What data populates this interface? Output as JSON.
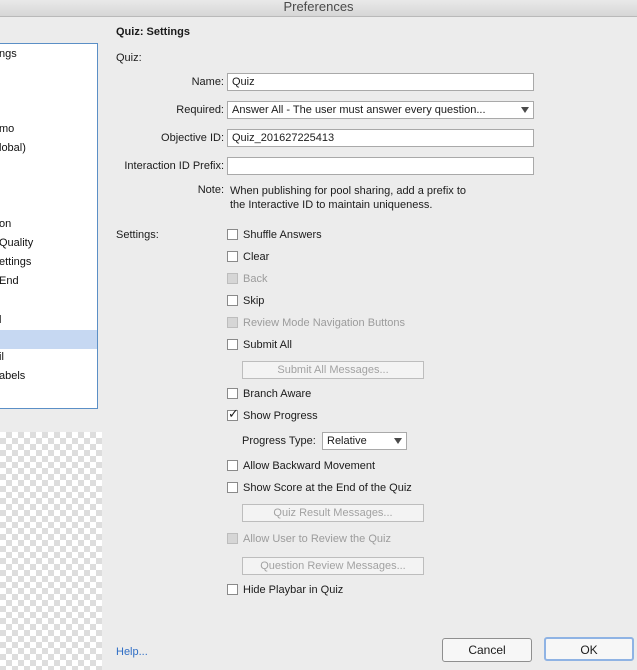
{
  "window": {
    "title": "Preferences"
  },
  "sidebar": {
    "items": [
      {
        "label": "ngs",
        "selected": false
      },
      {
        "label": "mo",
        "selected": false
      },
      {
        "label": "lobal)",
        "selected": false
      },
      {
        "label": "on",
        "selected": false
      },
      {
        "label": "Quality",
        "selected": false
      },
      {
        "label": "ettings",
        "selected": false
      },
      {
        "label": "End",
        "selected": false
      },
      {
        "label": "l",
        "selected": false
      },
      {
        "label": "",
        "selected": true
      },
      {
        "label": "il",
        "selected": false
      },
      {
        "label": "abels",
        "selected": false
      }
    ]
  },
  "panel": {
    "heading": "Quiz: Settings",
    "quiz_label": "Quiz:",
    "name_label": "Name:",
    "name_value": "Quiz",
    "required_label": "Required:",
    "required_value": "Answer All - The user must answer every question...",
    "objective_label": "Objective ID:",
    "objective_value": "Quiz_201627225413",
    "interaction_label": "Interaction ID Prefix:",
    "interaction_value": "",
    "note_label": "Note:",
    "note_line1": "When publishing for pool sharing, add a prefix to",
    "note_line2": "the Interactive ID to maintain uniqueness.",
    "settings_label": "Settings:",
    "options": {
      "shuffle_answers": {
        "label": "Shuffle Answers",
        "checked": false,
        "enabled": true
      },
      "clear": {
        "label": "Clear",
        "checked": false,
        "enabled": true
      },
      "back": {
        "label": "Back",
        "checked": false,
        "enabled": false
      },
      "skip": {
        "label": "Skip",
        "checked": false,
        "enabled": true
      },
      "review_mode_nav": {
        "label": "Review Mode Navigation Buttons",
        "checked": false,
        "enabled": false
      },
      "submit_all": {
        "label": "Submit All",
        "checked": false,
        "enabled": true
      },
      "branch_aware": {
        "label": "Branch Aware",
        "checked": false,
        "enabled": true
      },
      "show_progress": {
        "label": "Show Progress",
        "checked": true,
        "enabled": true
      },
      "allow_backward": {
        "label": "Allow Backward Movement",
        "checked": false,
        "enabled": true
      },
      "show_score": {
        "label": "Show Score at the End of the Quiz",
        "checked": false,
        "enabled": true
      },
      "allow_review": {
        "label": "Allow User to Review the Quiz",
        "checked": false,
        "enabled": false
      },
      "hide_playbar": {
        "label": "Hide Playbar in Quiz",
        "checked": false,
        "enabled": true
      }
    },
    "submit_all_messages_btn": "Submit All Messages...",
    "progress_type_label": "Progress Type:",
    "progress_type_value": "Relative",
    "quiz_result_messages_btn": "Quiz Result Messages...",
    "question_review_messages_btn": "Question Review Messages..."
  },
  "footer": {
    "help_label": "Help...",
    "cancel_label": "Cancel",
    "ok_label": "OK"
  }
}
